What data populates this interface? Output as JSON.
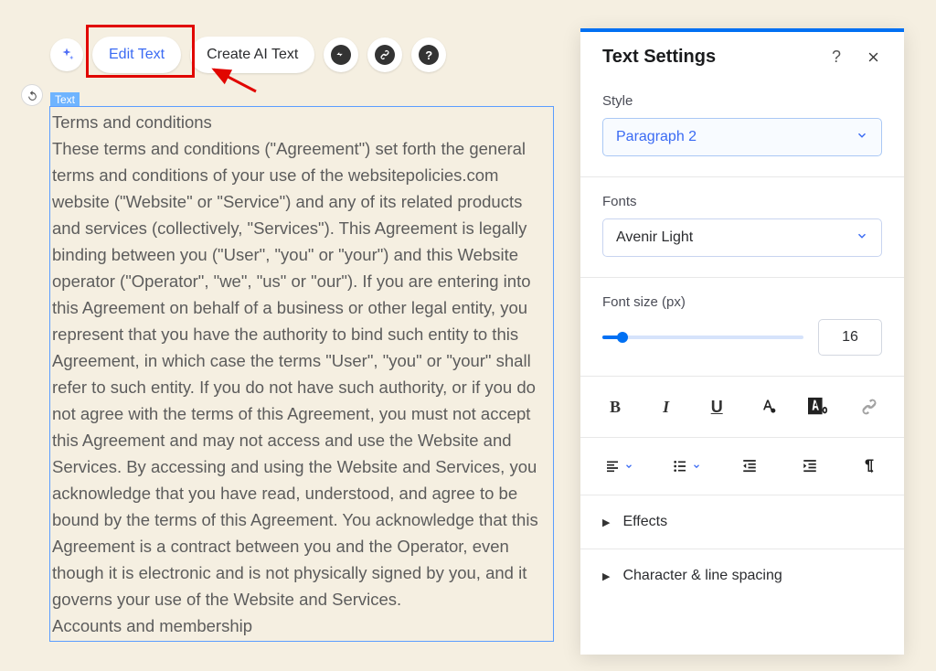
{
  "toolbar": {
    "edit_text_label": "Edit Text",
    "create_ai_label": "Create AI Text"
  },
  "text_element": {
    "label": "Text",
    "content": "Terms and conditions\nThese terms and conditions (\"Agreement\") set forth the general terms and conditions of your use of the websitepolicies.com website (\"Website\" or \"Service\") and any of its related products and services (collectively, \"Services\"). This Agreement is legally binding between you (\"User\", \"you\" or \"your\") and this Website operator (\"Operator\", \"we\", \"us\" or \"our\"). If you are entering into this Agreement on behalf of a business or other legal entity, you represent that you have the authority to bind such entity to this Agreement, in which case the terms \"User\", \"you\" or \"your\" shall refer to such entity. If you do not have such authority, or if you do not agree with the terms of this Agreement, you must not accept this Agreement and may not access and use the Website and Services. By accessing and using the Website and Services, you acknowledge that you have read, understood, and agree to be bound by the terms of this Agreement. You acknowledge that this Agreement is a contract between you and the Operator, even though it is electronic and is not physically signed by you, and it governs your use of the Website and Services.\nAccounts and membership"
  },
  "panel": {
    "title": "Text Settings",
    "help_label": "?",
    "style_label": "Style",
    "style_value": "Paragraph 2",
    "fonts_label": "Fonts",
    "fonts_value": "Avenir Light",
    "fontsize_label": "Font size (px)",
    "fontsize_value": "16",
    "effects_label": "Effects",
    "spacing_label": "Character & line spacing"
  }
}
